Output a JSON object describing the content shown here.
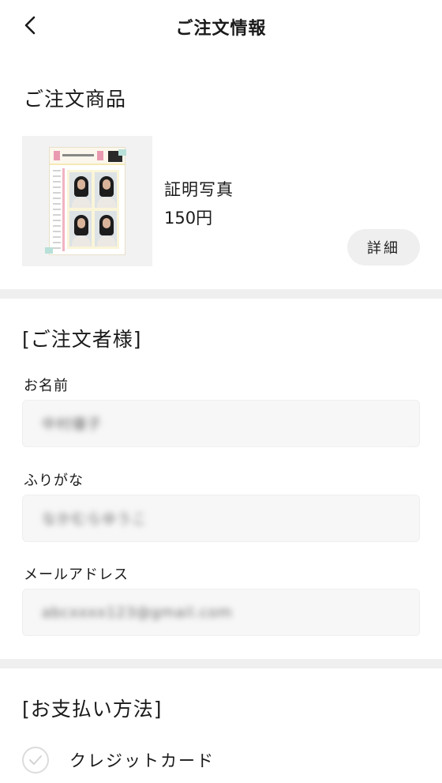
{
  "header": {
    "title": "ご注文情報",
    "back_icon": "chevron-left-icon"
  },
  "product_section": {
    "title": "ご注文商品",
    "item": {
      "name": "証明写真",
      "price": "150円",
      "detail_label": "詳細"
    }
  },
  "orderer_section": {
    "title": "[ご注文者様]",
    "fields": [
      {
        "label": "お名前",
        "value": "中村優子"
      },
      {
        "label": "ふりがな",
        "value": "なかむらゆうこ"
      },
      {
        "label": "メールアドレス",
        "value": "abcxxxx123@gmail.com"
      }
    ]
  },
  "payment_section": {
    "title": "[お支払い方法]",
    "options": [
      {
        "label": "クレジットカード",
        "icon": "check-circle-icon"
      }
    ]
  },
  "colors": {
    "background": "#ffffff",
    "divider": "#efefef",
    "field_bg": "#f7f7f7",
    "button_bg": "#efefef",
    "text": "#1a1a1a"
  }
}
